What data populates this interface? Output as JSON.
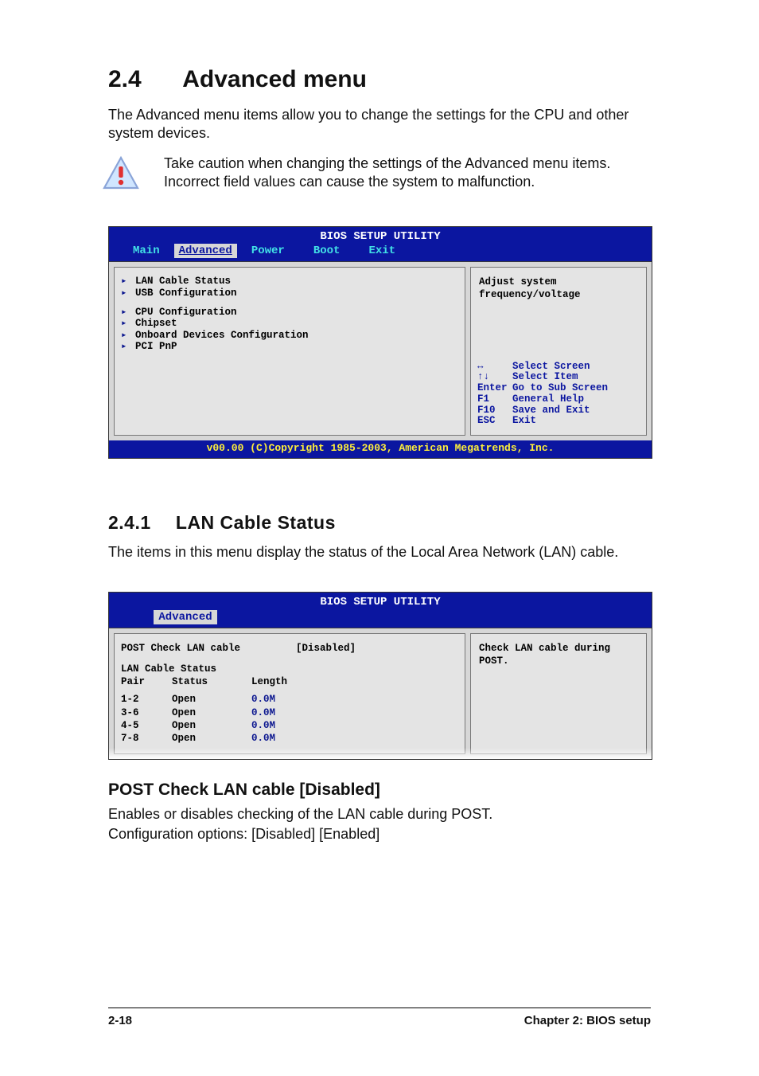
{
  "heading": {
    "number": "2.4",
    "title": "Advanced menu"
  },
  "intro": "The Advanced menu items allow you to change the settings for the CPU and other system devices.",
  "caution": "Take caution when changing the settings of the Advanced menu items. Incorrect field values can cause the system to malfunction.",
  "bios1": {
    "title": "BIOS SETUP UTILITY",
    "tabs": [
      "Main",
      "Advanced",
      "Power",
      "Boot",
      "Exit"
    ],
    "active_tab": "Advanced",
    "items_group1": [
      "LAN Cable Status",
      "USB Configuration"
    ],
    "items_group2": [
      "CPU Configuration",
      "Chipset",
      "Onboard Devices Configuration",
      "PCI PnP"
    ],
    "help": "Adjust system frequency/voltage",
    "keys": [
      {
        "k": "↔",
        "l": "Select Screen"
      },
      {
        "k": "↑↓",
        "l": "Select Item"
      },
      {
        "k": "Enter",
        "l": "Go to Sub Screen"
      },
      {
        "k": "F1",
        "l": "General Help"
      },
      {
        "k": "F10",
        "l": "Save and Exit"
      },
      {
        "k": "ESC",
        "l": "Exit"
      }
    ],
    "footer": "v00.00 (C)Copyright 1985-2003, American Megatrends, Inc."
  },
  "sub": {
    "number": "2.4.1",
    "title": "LAN Cable Status"
  },
  "sub_intro": "The items in this menu display the status of the Local Area Network (LAN) cable.",
  "bios2": {
    "title": "BIOS SETUP UTILITY",
    "tab": "Advanced",
    "field": {
      "name": "POST Check LAN cable",
      "value": "[Disabled]"
    },
    "table_title": "LAN Cable Status",
    "headers": {
      "pair": "Pair",
      "status": "Status",
      "length": "Length"
    },
    "rows": [
      {
        "pair": "1-2",
        "status": "Open",
        "length": "0.0M"
      },
      {
        "pair": "3-6",
        "status": "Open",
        "length": "0.0M"
      },
      {
        "pair": "4-5",
        "status": "Open",
        "length": "0.0M"
      },
      {
        "pair": "7-8",
        "status": "Open",
        "length": "0.0M"
      }
    ],
    "help": "Check LAN cable during POST."
  },
  "opt_heading": "POST Check LAN cable [Disabled]",
  "opt_p1": "Enables or disables checking of the LAN cable during POST.",
  "opt_p2": "Configuration options: [Disabled] [Enabled]",
  "footer": {
    "left": "2-18",
    "right": "Chapter 2: BIOS setup"
  }
}
